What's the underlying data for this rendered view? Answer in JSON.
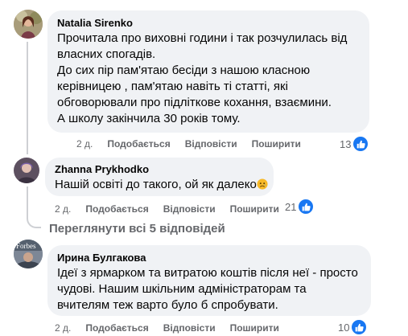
{
  "comments": [
    {
      "author": "Natalia Sirenko",
      "text": [
        "Прочитала про виховні години і так розчулилась від власних спогадів.",
        "До сих пір пам'ятаю бесіди з нашою класною керівницею , пам'ятаю навіть ті статті, які обговорювали про підліткове кохання, взаємини.",
        "А школу закінчила 30 років тому."
      ],
      "time": "2 д.",
      "like_label": "Подобається",
      "reply_label": "Відповісти",
      "share_label": "Поширити",
      "reaction_count": "13"
    },
    {
      "author": "Zhanna Prykhodko",
      "text": "Нашій освіті до такого, ой як далеко",
      "emoji": "sad-face-emoji",
      "time": "2 д.",
      "like_label": "Подобається",
      "reply_label": "Відповісти",
      "share_label": "Поширити",
      "reaction_count": "21"
    },
    {
      "author": "Ирина Булгакова",
      "avatar_text": "Forbes",
      "text": "Ідеї з ярмарком та витратою коштів після неї - просто чудові. Нашим шкільним адміністраторам та вчителям теж варто було б спробувати.",
      "time": "2 д.",
      "like_label": "Подобається",
      "reply_label": "Відповісти",
      "share_label": "Поширити",
      "reaction_count": "10"
    }
  ],
  "view_replies_label": "Переглянути всі 5 відповідей",
  "colors": {
    "bubble": "#f0f2f5",
    "secondary_text": "#65676b",
    "like_blue": "#1877f2",
    "thread_line": "#ced0d4"
  }
}
